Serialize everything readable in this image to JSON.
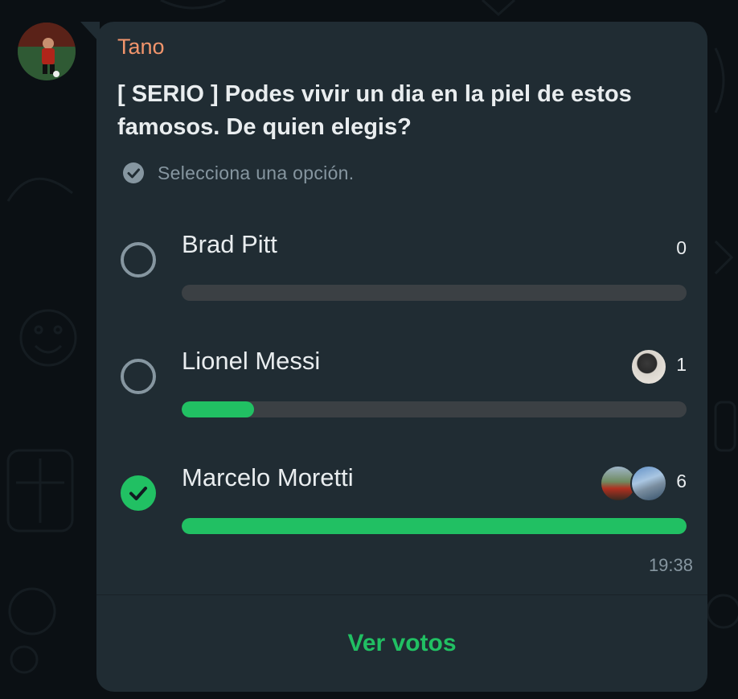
{
  "message": {
    "sender": "Tano",
    "sender_color": "#f2956c",
    "time": "19:38"
  },
  "poll": {
    "question": "[ SERIO ] Podes vivir un dia en la piel de estos famosos. De quien elegis?",
    "hint": "Selecciona una opción.",
    "hint_icon": "check-circle-icon",
    "accent_color": "#21c063",
    "options": [
      {
        "label": "Brad Pitt",
        "votes": "0",
        "fill_fraction": 0,
        "selected": false
      },
      {
        "label": "Lionel Messi",
        "votes": "1",
        "fill_fraction": 0.143,
        "selected": false
      },
      {
        "label": "Marcelo Moretti",
        "votes": "6",
        "fill_fraction": 1,
        "selected": true
      }
    ],
    "view_votes_label": "Ver votos"
  }
}
